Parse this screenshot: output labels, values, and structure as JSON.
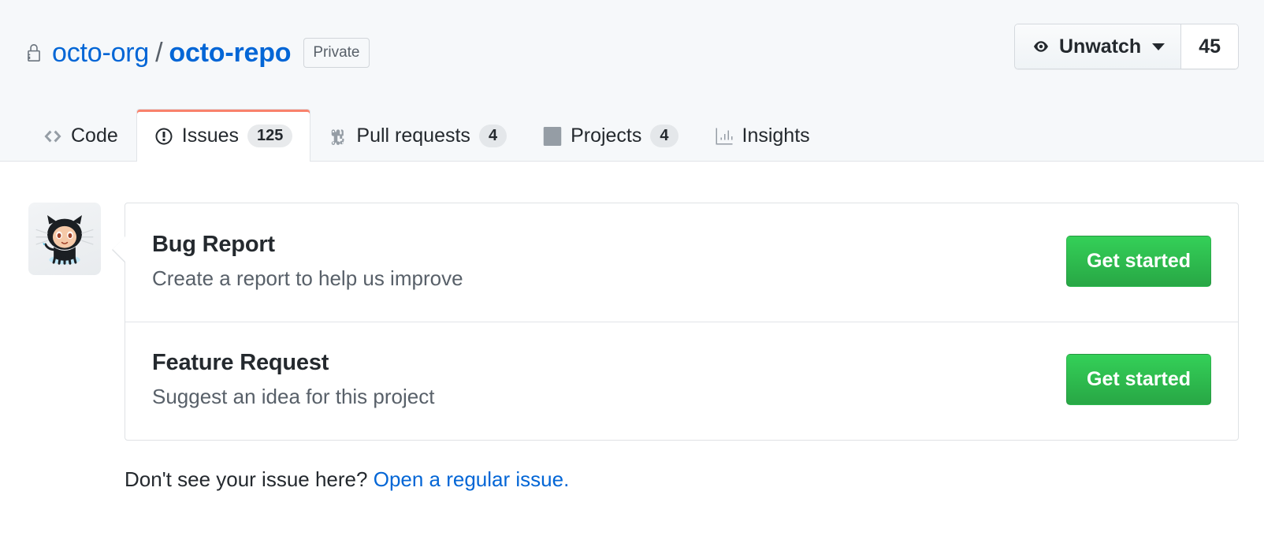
{
  "header": {
    "lock_icon": "lock-icon",
    "owner": "octo-org",
    "separator": "/",
    "repo": "octo-repo",
    "visibility_badge": "Private",
    "watch": {
      "icon": "eye-icon",
      "label": "Unwatch",
      "count": "45"
    }
  },
  "tabs": [
    {
      "id": "code",
      "icon": "code-icon",
      "label": "Code",
      "counter": null,
      "active": false
    },
    {
      "id": "issues",
      "icon": "issue-opened-icon",
      "label": "Issues",
      "counter": "125",
      "active": true
    },
    {
      "id": "pull-requests",
      "icon": "git-pull-request-icon",
      "label": "Pull requests",
      "counter": "4",
      "active": false
    },
    {
      "id": "projects",
      "icon": "project-board-icon",
      "label": "Projects",
      "counter": "4",
      "active": false
    },
    {
      "id": "insights",
      "icon": "graph-icon",
      "label": "Insights",
      "counter": null,
      "active": false
    }
  ],
  "main": {
    "avatar_icon": "octocat-avatar",
    "templates": [
      {
        "title": "Bug Report",
        "description": "Create a report to help us improve",
        "action_label": "Get started"
      },
      {
        "title": "Feature Request",
        "description": "Suggest an idea for this project",
        "action_label": "Get started"
      }
    ],
    "footer": {
      "text": "Don't see your issue here?",
      "link_label": "Open a regular issue."
    }
  },
  "colors": {
    "link": "#0366d6",
    "active_tab_underline": "#f9826c",
    "button_green": "#28a745",
    "header_bg": "#f6f8fa",
    "border": "#e1e4e8"
  }
}
